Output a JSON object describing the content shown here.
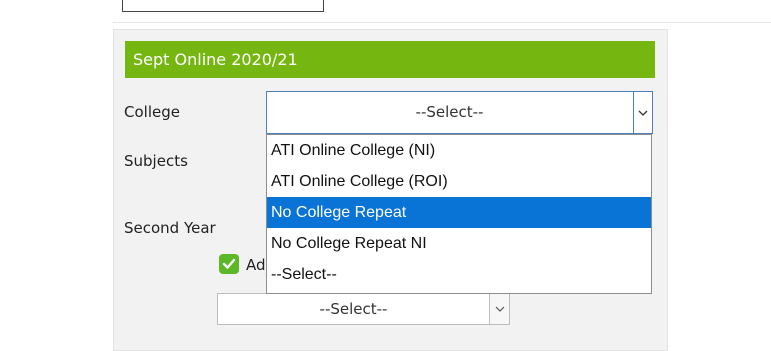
{
  "panel": {
    "title": "Sept Online 2020/21",
    "header_color": "#75b710"
  },
  "fields": {
    "college_label": "College",
    "subjects_label": "Subjects",
    "second_year_label": "Second Year",
    "checkbox_label_partial": "Ad"
  },
  "college_select": {
    "value": "--Select--",
    "open": true,
    "options": [
      {
        "label": "ATI Online College (NI)",
        "highlighted": false
      },
      {
        "label": "ATI Online College (ROI)",
        "highlighted": false
      },
      {
        "label": "No College Repeat",
        "highlighted": true
      },
      {
        "label": "No College Repeat NI",
        "highlighted": false
      },
      {
        "label": "--Select--",
        "highlighted": false
      }
    ],
    "highlight_color": "#0a73d6"
  },
  "second_year_select": {
    "value": "--Select--"
  },
  "checkbox": {
    "checked": true,
    "color": "#5cb826"
  },
  "icons": {
    "dropdown_arrow": "chevron-down-icon",
    "checkbox": "checkmark-icon"
  }
}
